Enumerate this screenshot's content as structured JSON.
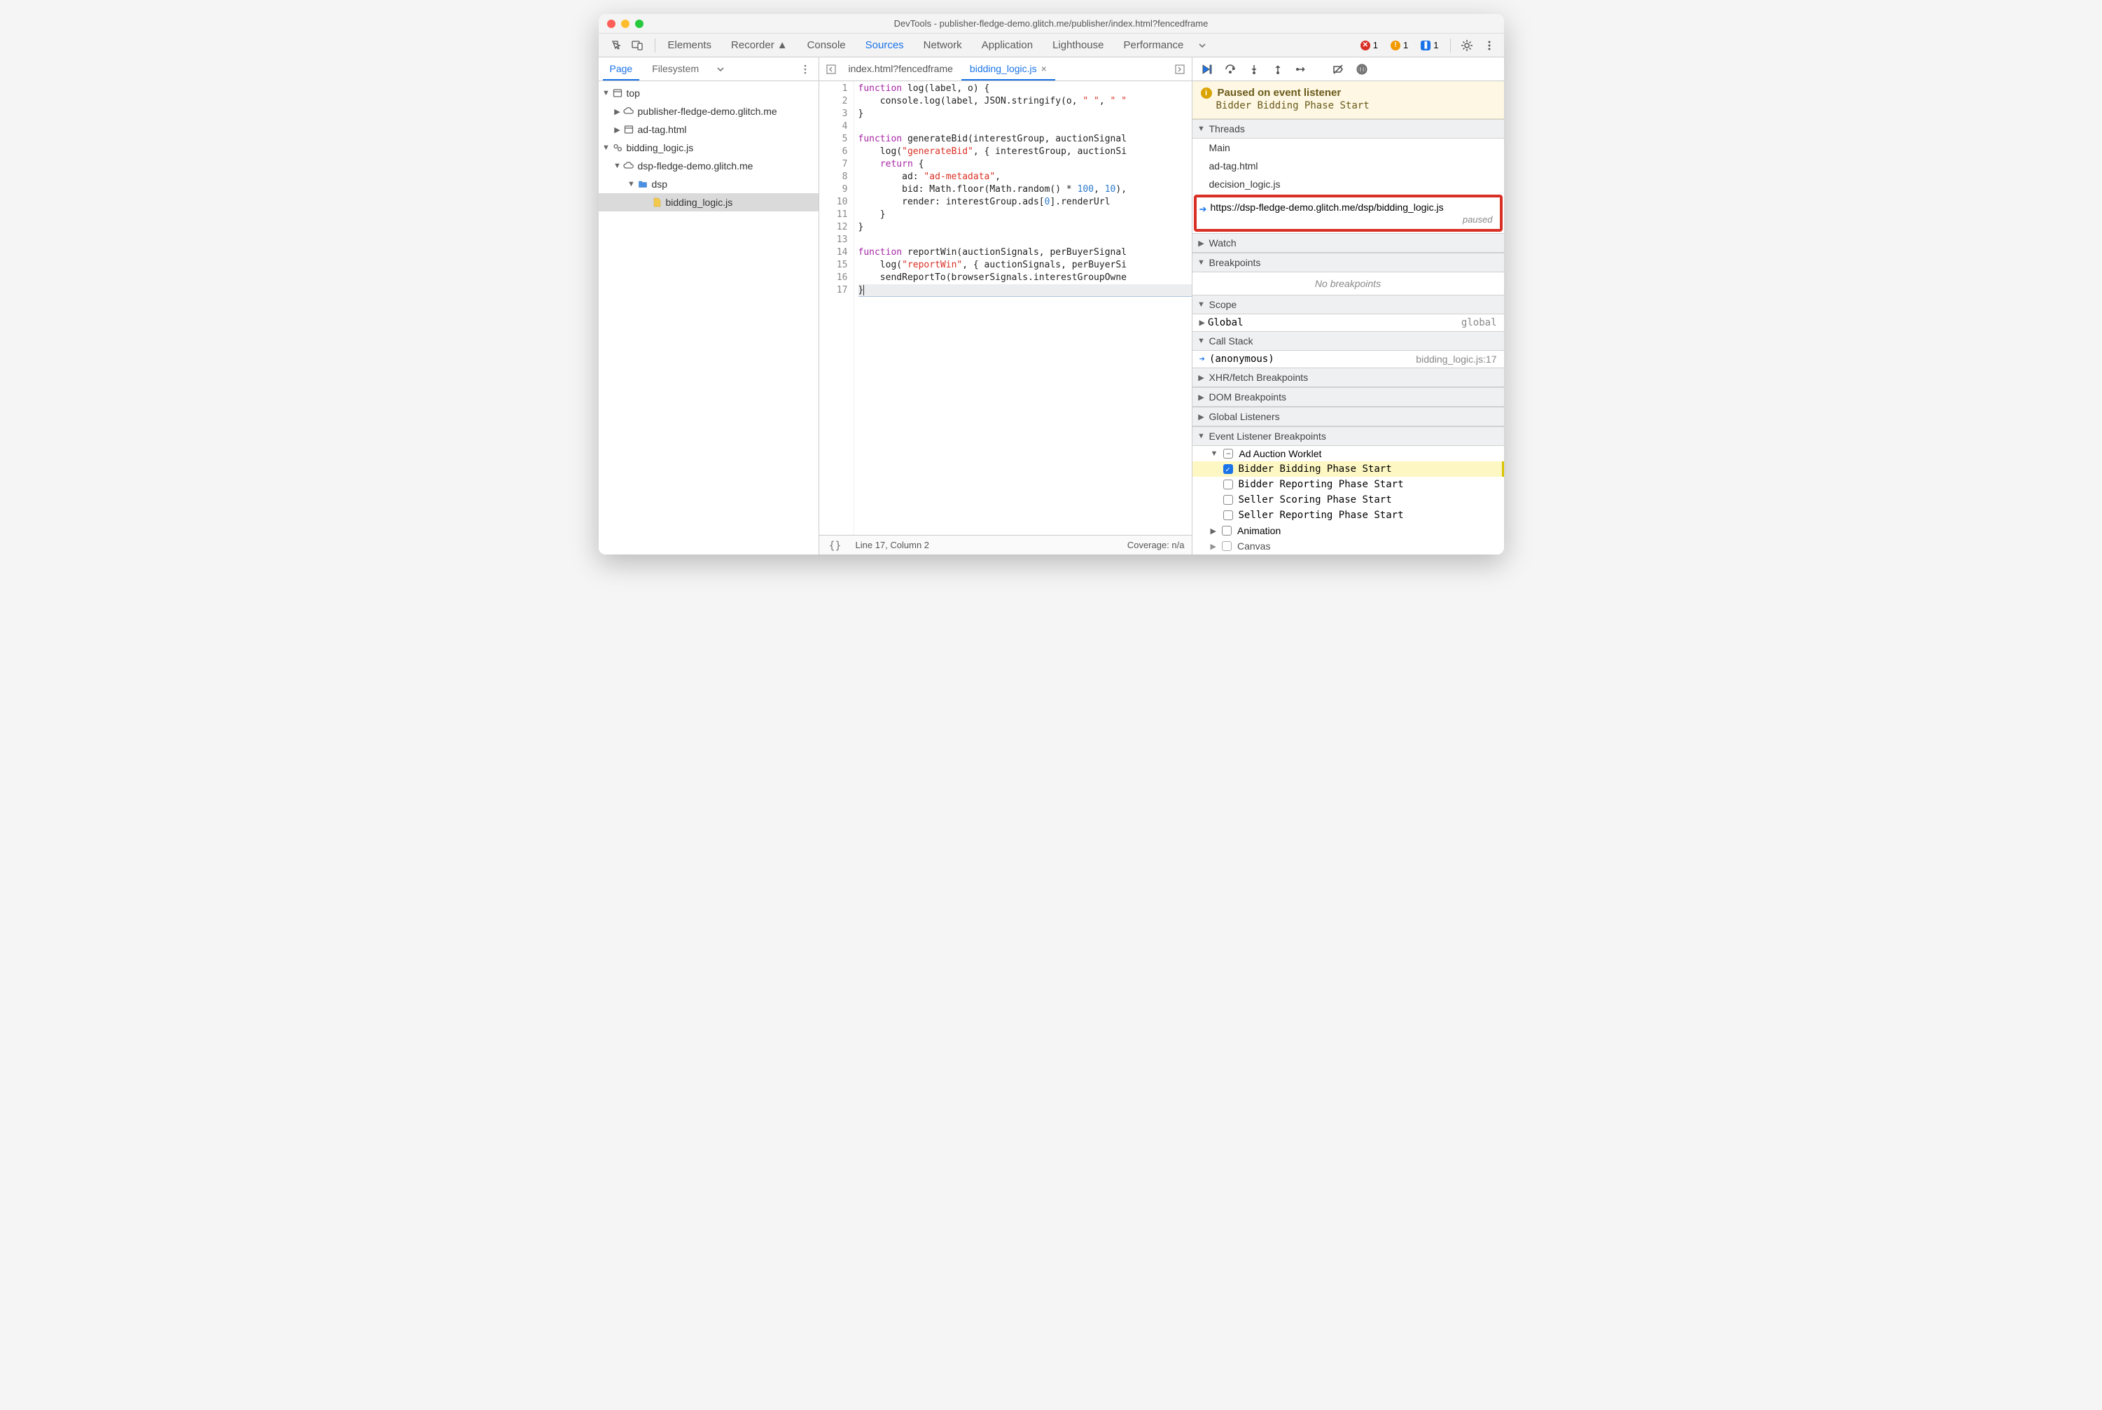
{
  "window": {
    "title": "DevTools - publisher-fledge-demo.glitch.me/publisher/index.html?fencedframe"
  },
  "toolbar": {
    "tabs": [
      "Elements",
      "Recorder",
      "Console",
      "Sources",
      "Network",
      "Application",
      "Lighthouse",
      "Performance"
    ],
    "active_tab": "Sources",
    "errors": "1",
    "warnings": "1",
    "issues": "1"
  },
  "navigator": {
    "tabs": [
      "Page",
      "Filesystem"
    ],
    "active_tab": "Page",
    "tree": {
      "top": "top",
      "top_domain": "publisher-fledge-demo.glitch.me",
      "top_file": "ad-tag.html",
      "worklet": "bidding_logic.js",
      "worklet_domain": "dsp-fledge-demo.glitch.me",
      "worklet_folder": "dsp",
      "worklet_file": "bidding_logic.js"
    }
  },
  "editor": {
    "tabs": [
      {
        "label": "index.html?fencedframe",
        "active": false
      },
      {
        "label": "bidding_logic.js",
        "active": true
      }
    ],
    "code_lines": [
      "function log(label, o) {",
      "    console.log(label, JSON.stringify(o, \" \", \" \"",
      "}",
      "",
      "function generateBid(interestGroup, auctionSignal",
      "    log(\"generateBid\", { interestGroup, auctionSi",
      "    return {",
      "        ad: \"ad-metadata\",",
      "        bid: Math.floor(Math.random() * 100, 10),",
      "        render: interestGroup.ads[0].renderUrl",
      "    }",
      "}",
      "",
      "function reportWin(auctionSignals, perBuyerSignal",
      "    log(\"reportWin\", { auctionSignals, perBuyerSi",
      "    sendReportTo(browserSignals.interestGroupOwne",
      "}"
    ],
    "status": {
      "position": "Line 17, Column 2",
      "coverage": "Coverage: n/a"
    }
  },
  "debug": {
    "paused_title": "Paused on event listener",
    "paused_sub": "Bidder Bidding Phase Start",
    "sections": {
      "threads": "Threads",
      "watch": "Watch",
      "breakpoints": "Breakpoints",
      "scope": "Scope",
      "callstack": "Call Stack",
      "xhr": "XHR/fetch Breakpoints",
      "dom": "DOM Breakpoints",
      "global": "Global Listeners",
      "elb": "Event Listener Breakpoints"
    },
    "threads": {
      "items": [
        "Main",
        "ad-tag.html",
        "decision_logic.js"
      ],
      "active_url": "https://dsp-fledge-demo.glitch.me/dsp/bidding_logic.js",
      "active_status": "paused"
    },
    "breakpoints_empty": "No breakpoints",
    "scope": {
      "label": "Global",
      "value": "global"
    },
    "callstack": {
      "frame": "(anonymous)",
      "location": "bidding_logic.js:17"
    },
    "elb": {
      "category": "Ad Auction Worklet",
      "items": [
        {
          "label": "Bidder Bidding Phase Start",
          "checked": true
        },
        {
          "label": "Bidder Reporting Phase Start",
          "checked": false
        },
        {
          "label": "Seller Scoring Phase Start",
          "checked": false
        },
        {
          "label": "Seller Reporting Phase Start",
          "checked": false
        }
      ],
      "animation": "Animation",
      "canvas": "Canvas"
    }
  }
}
